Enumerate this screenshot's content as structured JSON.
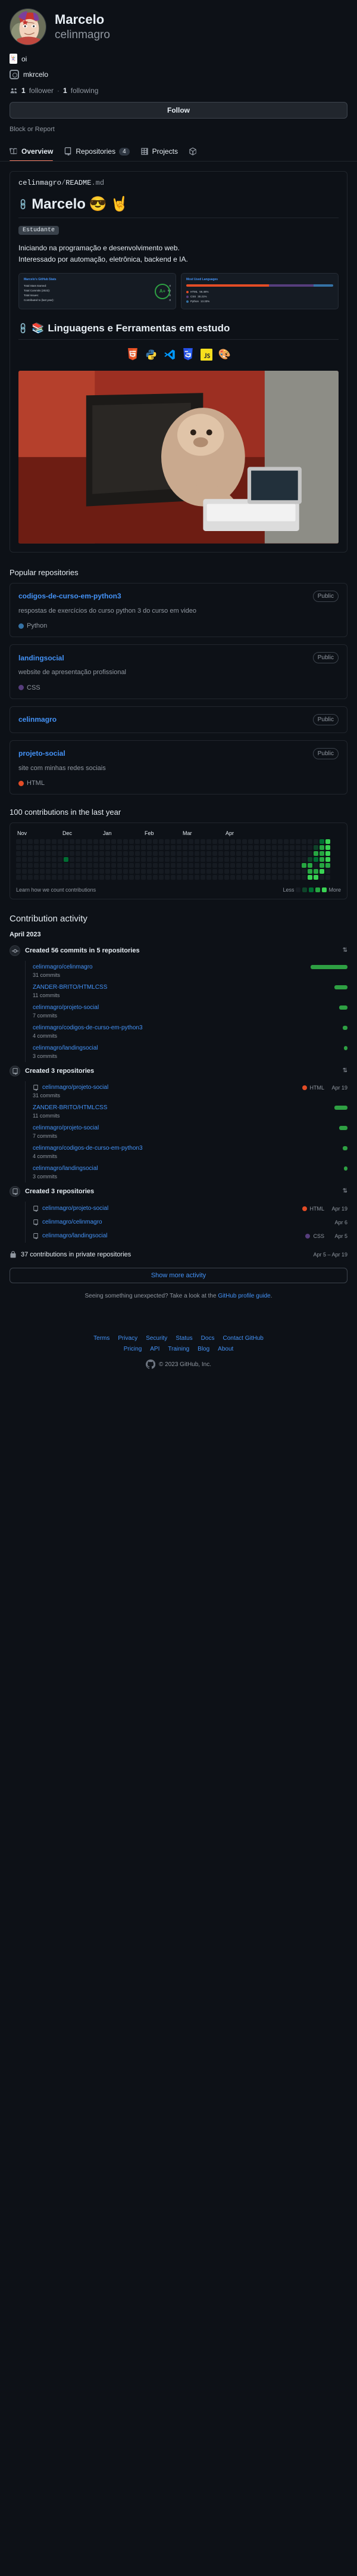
{
  "profile": {
    "full_name": "Marcelo",
    "username": "celinmagro",
    "avatar_alt": "avatar",
    "bio_emoji": "joker-card",
    "bio_text": "oi",
    "social_icon": "instagram-icon",
    "social_handle": "mkrcelo",
    "followers_icon": "people-icon",
    "followers_count": "1",
    "followers_label": "follower",
    "separator": "·",
    "following_count": "1",
    "following_label": "following",
    "follow_button": "Follow",
    "block_report": "Block or Report"
  },
  "tabs": [
    {
      "label": "Overview",
      "icon": "book-icon",
      "active": true,
      "count": null
    },
    {
      "label": "Repositories",
      "icon": "repo-icon",
      "active": false,
      "count": "4"
    },
    {
      "label": "Projects",
      "icon": "table-icon",
      "active": false,
      "count": null
    },
    {
      "label": "Packages",
      "icon": "package-icon",
      "active": false,
      "count": null
    }
  ],
  "readme": {
    "owner": "celinmagro",
    "slash": "/",
    "file": "README",
    "ext": ".md",
    "heading": "Marcelo",
    "heading_emoji_1": "😎",
    "heading_emoji_2": "🤘",
    "badge": "Estudante",
    "paragraph_line1": "Iniciando na programação e desenvolvimento web.",
    "paragraph_line2": "Interessado por automação, eletrônica, backend e IA.",
    "stats": {
      "card1_title": "Marcelo's GitHub Stats",
      "rows": [
        {
          "label": "Total Stars Earned:",
          "value": "0"
        },
        {
          "label": "Total Commits (2023):",
          "value": "56"
        },
        {
          "label": "Total Issues:",
          "value": "0"
        },
        {
          "label": "Contributed to (last year):",
          "value": "0"
        }
      ],
      "rank": "A+",
      "card2_title": "Most Used Languages",
      "languages": [
        {
          "name": "HTML",
          "pct": "56.46%",
          "color": "#e34c26"
        },
        {
          "name": "CSS",
          "pct": "30.21%",
          "color": "#563d7c"
        },
        {
          "name": "Python",
          "pct": "13.33%",
          "color": "#3572A5"
        }
      ]
    },
    "heading2": "Linguagens e Ferramentas em estudo",
    "tech_icons": [
      "html5-icon",
      "python-icon",
      "vscode-icon",
      "css3-icon",
      "javascript-icon",
      "palette-icon"
    ]
  },
  "popular_repositories": {
    "title": "Popular repositories",
    "repos": [
      {
        "name": "codigos-de-curso-em-python3",
        "visibility": "Public",
        "description": "respostas de exercícios do curso python 3 do curso em video",
        "language": "Python",
        "language_color": "#3572A5"
      },
      {
        "name": "landingsocial",
        "visibility": "Public",
        "description": "website de apresentação profissional",
        "language": "CSS",
        "language_color": "#563d7c"
      },
      {
        "name": "celinmagro",
        "visibility": "Public",
        "description": "",
        "language": "",
        "language_color": ""
      },
      {
        "name": "projeto-social",
        "visibility": "Public",
        "description": "site com minhas redes sociais",
        "language": "HTML",
        "language_color": "#e34c26"
      }
    ]
  },
  "contributions": {
    "title": "100 contributions in the last year",
    "months": [
      "Nov",
      "Dec",
      "Jan",
      "Feb",
      "Mar",
      "Apr"
    ],
    "learn_link": "Learn how we count contributions",
    "legend_less": "Less",
    "legend_more": "More",
    "legend_colors": [
      "#161b22",
      "#0e4429",
      "#006d32",
      "#26a641",
      "#39d353"
    ]
  },
  "activity": {
    "title": "Contribution activity",
    "month": "April 2023",
    "blocks": [
      {
        "icon": "commit-icon",
        "title": "Created 56 commits in 5 repositories",
        "type": "commits",
        "rows": [
          {
            "repo": "celinmagro/celinmagro",
            "sub": "31 commits",
            "bar_pct": 100
          },
          {
            "repo": "ZANDER-BRITO/HTMLCSS",
            "sub": "11 commits",
            "bar_pct": 35
          },
          {
            "repo": "celinmagro/projeto-social",
            "sub": "7 commits",
            "bar_pct": 22
          },
          {
            "repo": "celinmagro/codigos-de-curso-em-python3",
            "sub": "4 commits",
            "bar_pct": 13
          },
          {
            "repo": "celinmagro/landingsocial",
            "sub": "3 commits",
            "bar_pct": 9
          }
        ]
      },
      {
        "icon": "repo-icon",
        "title": "Created 3 repositories",
        "type": "repos-created",
        "rows": [
          {
            "repo": "celinmagro/projeto-social",
            "sub": "31 commits",
            "lang": "HTML",
            "lang_color": "#e34c26",
            "date": "Apr 19",
            "bar_pct": 0
          },
          {
            "repo": "ZANDER-BRITO/HTMLCSS",
            "sub": "11 commits",
            "lang": "",
            "lang_color": "",
            "date": "",
            "bar_pct": 35
          },
          {
            "repo": "celinmagro/projeto-social",
            "sub": "7 commits",
            "lang": "",
            "lang_color": "",
            "date": "",
            "bar_pct": 22
          },
          {
            "repo": "celinmagro/codigos-de-curso-em-python3",
            "sub": "4 commits",
            "lang": "",
            "lang_color": "",
            "date": "",
            "bar_pct": 13
          },
          {
            "repo": "celinmagro/landingsocial",
            "sub": "3 commits",
            "lang": "",
            "lang_color": "",
            "date": "",
            "bar_pct": 9
          }
        ]
      },
      {
        "icon": "repo-icon",
        "title": "Created 3 repositories",
        "type": "repos-list",
        "rows": [
          {
            "repo": "celinmagro/projeto-social",
            "lang": "HTML",
            "lang_color": "#e34c26",
            "date": "Apr 19"
          },
          {
            "repo": "celinmagro/celinmagro",
            "lang": "",
            "lang_color": "",
            "date": "Apr 6"
          },
          {
            "repo": "celinmagro/landingsocial",
            "lang": "CSS",
            "lang_color": "#563d7c",
            "date": "Apr 5"
          }
        ]
      }
    ],
    "private_icon": "lock-icon",
    "private_text": "37 contributions in private repositories",
    "private_range": "Apr 5 – Apr 19",
    "show_more": "Show more activity",
    "seeing_prefix": "Seeing something unexpected? Take a look at the ",
    "seeing_link": "GitHub profile guide",
    "seeing_suffix": "."
  },
  "footer": {
    "row1": [
      "Terms",
      "Privacy",
      "Security",
      "Status",
      "Docs",
      "Contact GitHub"
    ],
    "row2": [
      "Pricing",
      "API",
      "Training",
      "Blog",
      "About"
    ],
    "copyright": "© 2023 GitHub, Inc.",
    "logo": "github-mark-icon"
  }
}
